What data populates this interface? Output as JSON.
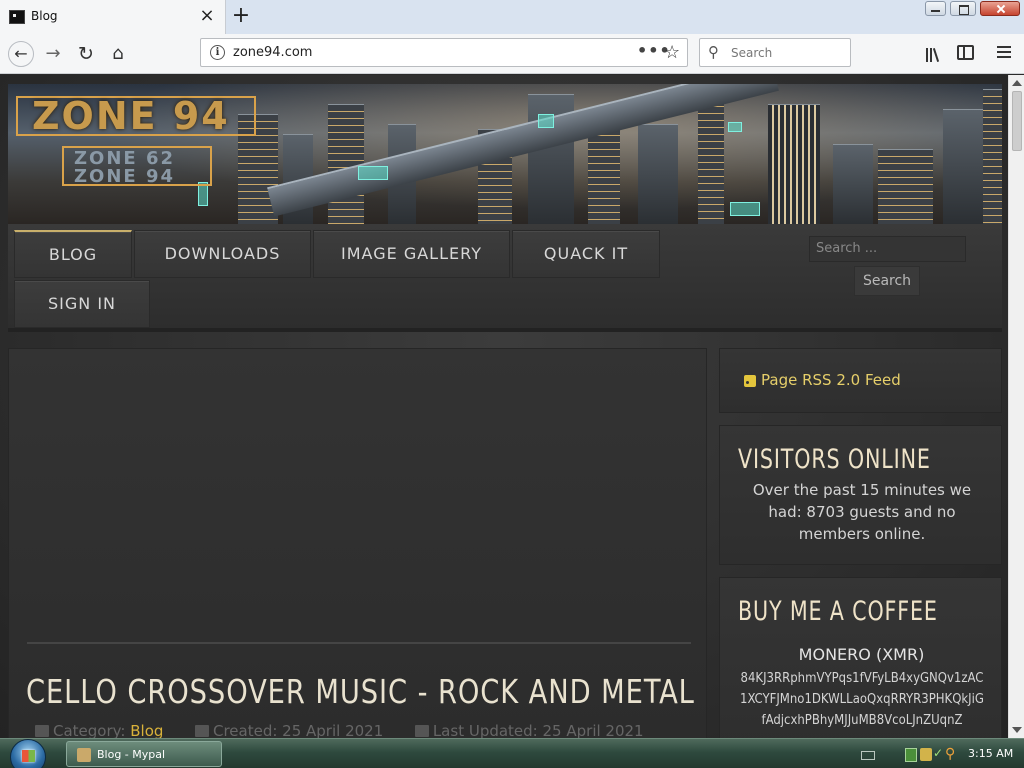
{
  "browser": {
    "tab_title": "Blog",
    "tab_close": "×",
    "new_tab": "+",
    "url": "zone94.com",
    "page_actions": "•••",
    "bookmark": "☆",
    "search_placeholder": "Search",
    "back": "←",
    "forward": "→",
    "reload": "↻",
    "home": "⌂",
    "search_icon": "⚲",
    "info": "i"
  },
  "site": {
    "logo_main": "ZONE 94",
    "logo_sub1": "ZONE 62",
    "logo_sub2": "ZONE 94",
    "menu": [
      {
        "label": "BLOG",
        "active": true
      },
      {
        "label": "DOWNLOADS"
      },
      {
        "label": "IMAGE GALLERY"
      },
      {
        "label": "QUACK IT"
      },
      {
        "label": "SIGN IN"
      }
    ],
    "search_placeholder": "Search ...",
    "search_button": "Search"
  },
  "article": {
    "title": "CELLO CROSSOVER MUSIC - ROCK AND METAL",
    "category_label": "Category: ",
    "category": "Blog",
    "created": "Created: 25 April 2021",
    "updated": "Last Updated: 25 April 2021"
  },
  "sidebar": {
    "rss": "Page RSS 2.0 Feed",
    "visitors_title": "VISITORS ONLINE",
    "visitors_text": "Over the past 15 minutes we had: 8703 guests and no members online.",
    "coffee_title": "BUY ME A COFFEE",
    "coin": "MONERO (XMR)",
    "address": "84KJ3RRphmVYPqs1fVFyLB4xyGNQv1zAC1XCYFJMno1DKWLLaoQxqRRYR3PHKQkJiGfAdjcxhPBhyMJJuMB8VcoLJnZUqnZ"
  },
  "taskbar": {
    "task_label": "Blog - Mypal",
    "clock": "3:15 AM"
  },
  "colors": {
    "accent_gold": "#d9b23a",
    "rss_yellow": "#e6cf6a",
    "page_bg": "#2b2b2b"
  }
}
